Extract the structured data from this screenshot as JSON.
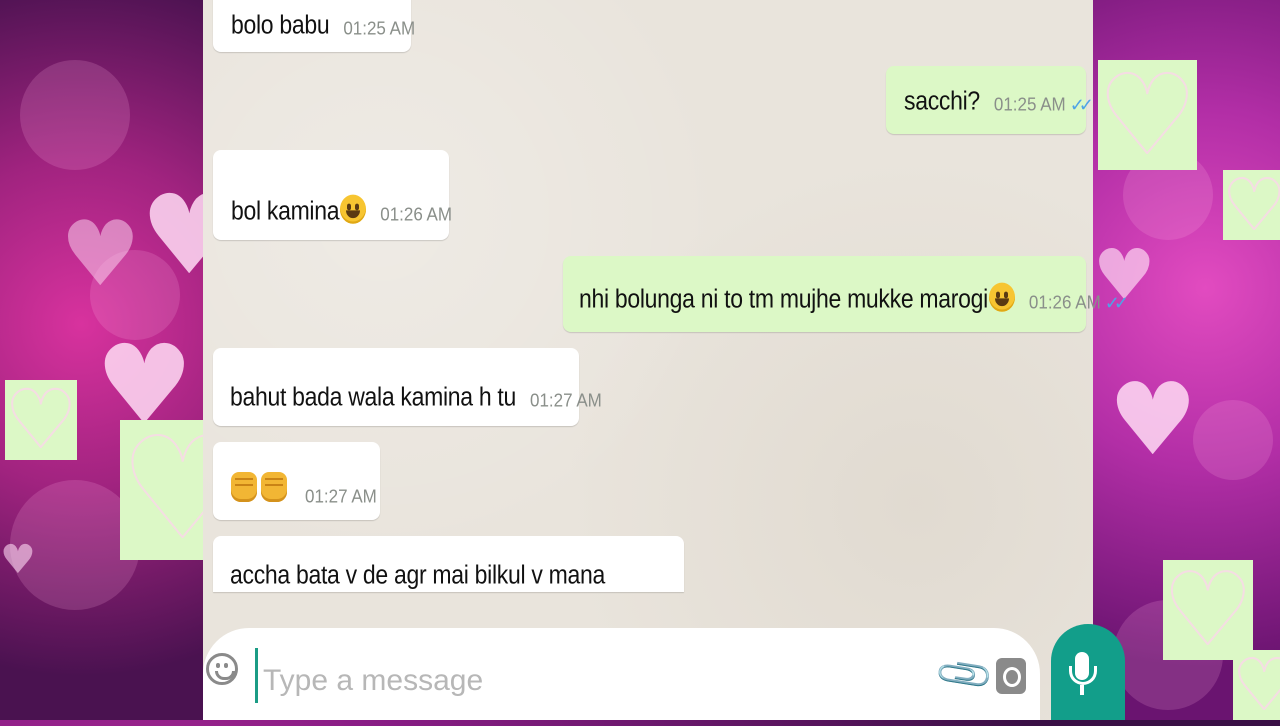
{
  "messages": [
    {
      "dir": "in",
      "text": "bolo babu",
      "time": "01:25 AM"
    },
    {
      "dir": "out",
      "text": "sacchi?",
      "time": "01:25 AM"
    },
    {
      "dir": "in",
      "text": "bol kamina",
      "time": "01:26 AM",
      "emoji": "laughing-emoji"
    },
    {
      "dir": "out",
      "text": "nhi bolunga ni to tm mujhe mukke marogi",
      "time": "01:26 AM",
      "emoji": "grinning-emoji"
    },
    {
      "dir": "in",
      "text": "bahut bada wala kamina h tu",
      "time": "01:27 AM"
    },
    {
      "dir": "in",
      "text": "",
      "time": "01:27 AM",
      "emoji": "fist-bump-emoji"
    },
    {
      "dir": "in",
      "text": "accha bata v de agr mai bilkul v mana",
      "time": ""
    }
  ],
  "read_ticks": "✓✓",
  "composer": {
    "placeholder": "Type a message",
    "emoji_icon": "smiley-icon",
    "attach_icon": "paperclip-icon",
    "camera_icon": "camera-icon",
    "mic_icon": "microphone-icon"
  },
  "colors": {
    "incoming": "#ffffff",
    "outgoing": "#dcf8c6",
    "chat_bg": "#e9e4dc",
    "accent": "#129e8a",
    "tick": "#4fa3e6"
  }
}
